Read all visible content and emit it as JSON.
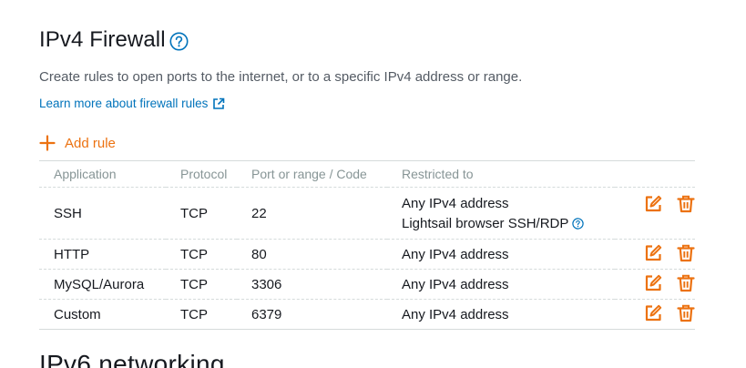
{
  "section": {
    "title": "IPv4 Firewall",
    "help_icon": "question-circle-icon",
    "description": "Create rules to open ports to the internet, or to a specific IPv4 address or range.",
    "learn_link": "Learn more about firewall rules",
    "learn_link_icon": "external-link-icon"
  },
  "add_rule": {
    "label": "Add rule",
    "icon": "plus-icon"
  },
  "table": {
    "columns": [
      "Application",
      "Protocol",
      "Port or range / Code",
      "Restricted to"
    ],
    "rows": [
      {
        "application": "SSH",
        "protocol": "TCP",
        "port": "22",
        "restricted": "Any IPv4 address",
        "restricted_extra": "Lightsail browser SSH/RDP"
      },
      {
        "application": "HTTP",
        "protocol": "TCP",
        "port": "80",
        "restricted": "Any IPv4 address"
      },
      {
        "application": "MySQL/Aurora",
        "protocol": "TCP",
        "port": "3306",
        "restricted": "Any IPv4 address"
      },
      {
        "application": "Custom",
        "protocol": "TCP",
        "port": "6379",
        "restricted": "Any IPv4 address"
      }
    ],
    "row_icons": [
      "edit-icon",
      "delete-icon"
    ]
  },
  "next_section": {
    "title": "IPv6 networking"
  },
  "colors": {
    "accent": "#ec7211",
    "link": "#0073bb",
    "muted": "#879596",
    "text": "#16191f"
  }
}
